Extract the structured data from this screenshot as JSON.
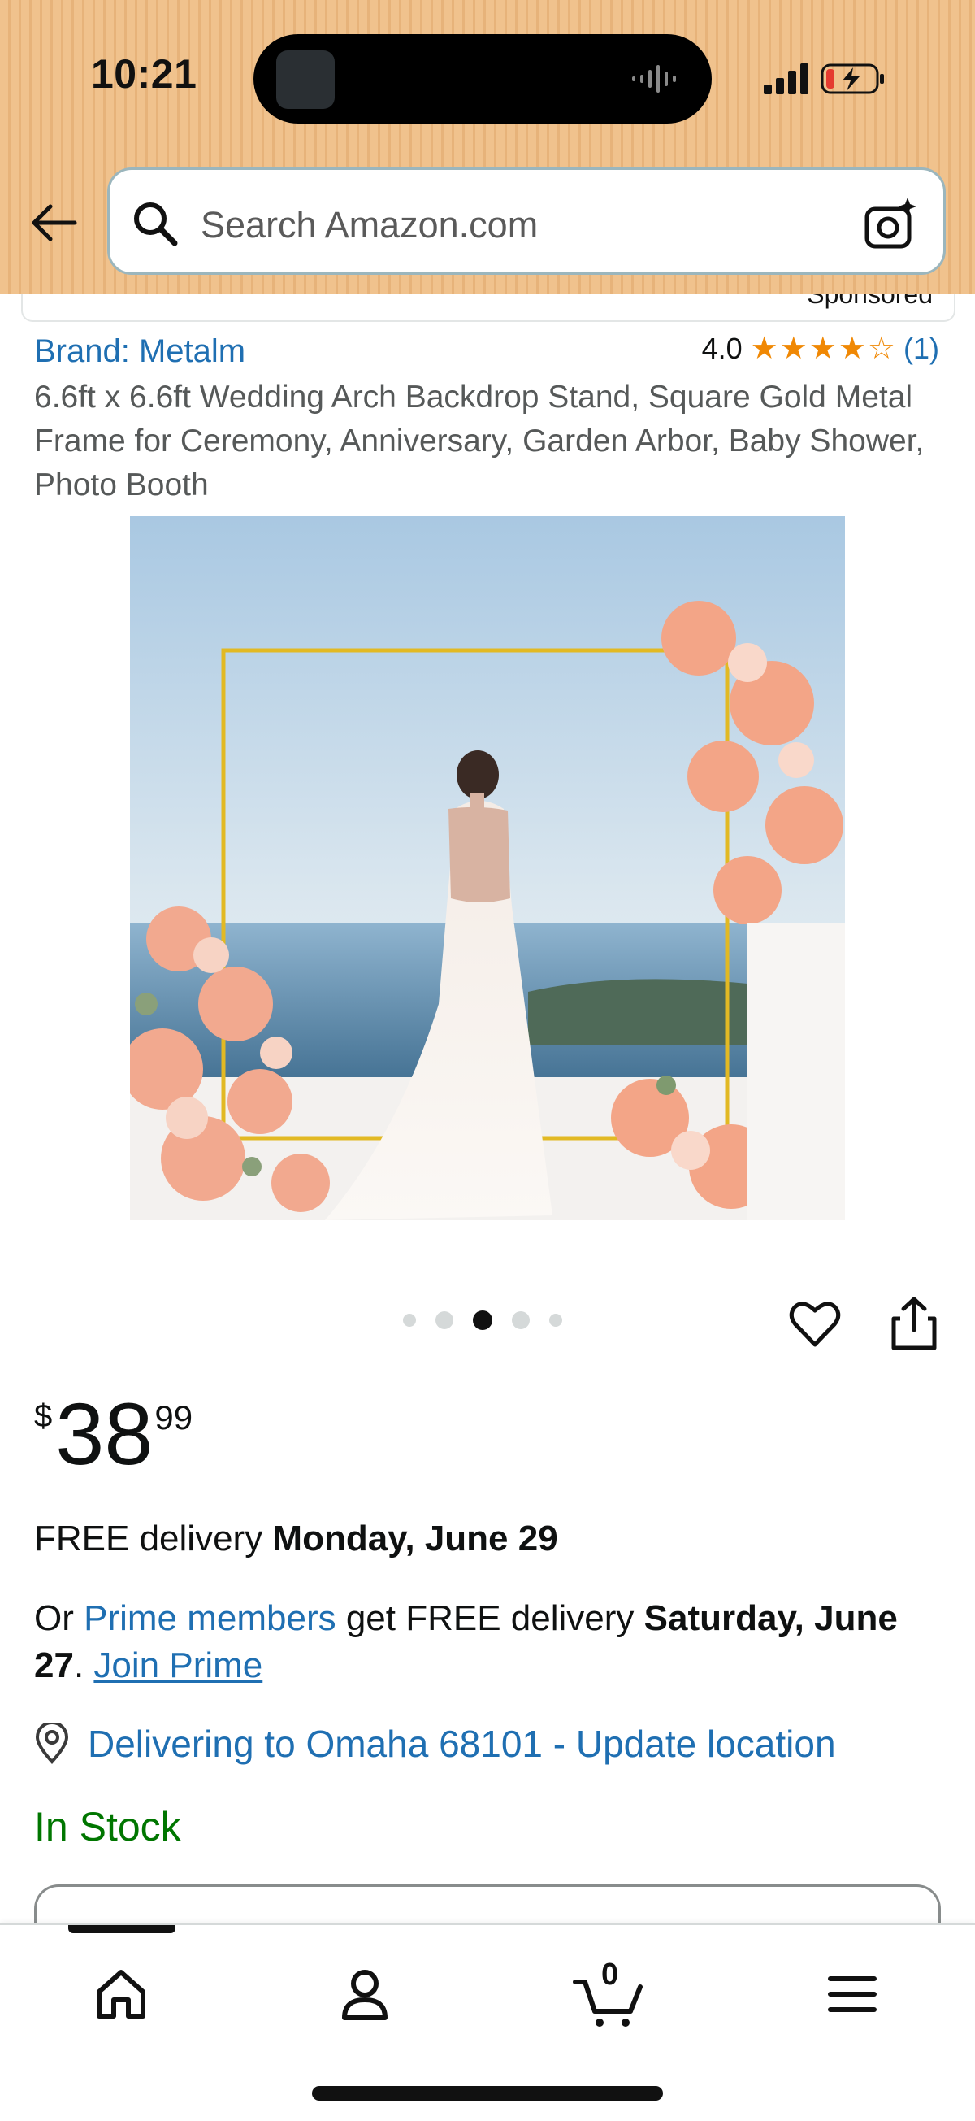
{
  "status_bar": {
    "time": "10:21"
  },
  "header": {
    "search_placeholder": "Search Amazon.com"
  },
  "sponsored": {
    "label": "Sponsored"
  },
  "product": {
    "brand": "Brand: Metalm",
    "rating": "4.0",
    "rating_stars": 4,
    "rating_count": "(1)",
    "title": "6.6ft x 6.6ft Wedding Arch Backdrop Stand, Square Gold Metal Frame for Ceremony, Anniversary, Garden Arbor, Baby Shower, Photo Booth",
    "image_count": 5,
    "active_image_index": 2
  },
  "price": {
    "currency": "$",
    "whole": "38",
    "fraction": "99"
  },
  "delivery": {
    "free_prefix": "FREE delivery ",
    "free_date": "Monday, June 29",
    "prime_or": "Or ",
    "prime_members": "Prime members",
    "prime_mid": " get FREE delivery ",
    "prime_date": "Saturday, June 27",
    "prime_period": ". ",
    "join_prime": "Join Prime",
    "location": "Delivering to Omaha 68101 - Update location"
  },
  "stock": {
    "status": "In Stock"
  },
  "bottom_nav": {
    "cart_count": "0",
    "items": [
      "home-icon",
      "account-icon",
      "cart-icon",
      "menu-icon"
    ]
  },
  "colors": {
    "header_bg": "#f0c28d",
    "link_blue": "#1f6fb2",
    "star_orange": "#f08804",
    "in_stock_green": "#007600"
  }
}
